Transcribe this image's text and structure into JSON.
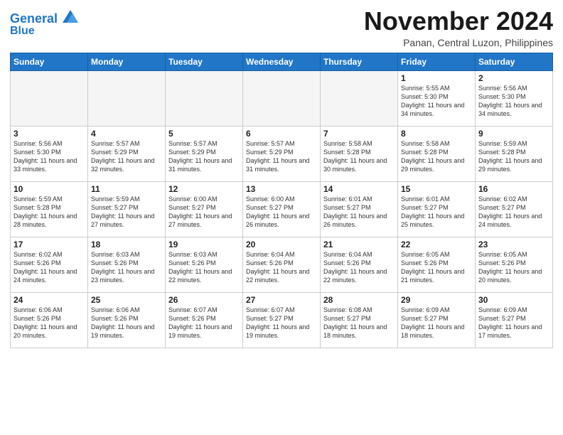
{
  "header": {
    "logo_line1": "General",
    "logo_line2": "Blue",
    "month": "November 2024",
    "location": "Panan, Central Luzon, Philippines"
  },
  "weekdays": [
    "Sunday",
    "Monday",
    "Tuesday",
    "Wednesday",
    "Thursday",
    "Friday",
    "Saturday"
  ],
  "weeks": [
    [
      {
        "day": "",
        "empty": true
      },
      {
        "day": "",
        "empty": true
      },
      {
        "day": "",
        "empty": true
      },
      {
        "day": "",
        "empty": true
      },
      {
        "day": "",
        "empty": true
      },
      {
        "day": "1",
        "sunrise": "5:55 AM",
        "sunset": "5:30 PM",
        "daylight": "11 hours and 34 minutes."
      },
      {
        "day": "2",
        "sunrise": "5:56 AM",
        "sunset": "5:30 PM",
        "daylight": "11 hours and 34 minutes."
      }
    ],
    [
      {
        "day": "3",
        "sunrise": "5:56 AM",
        "sunset": "5:30 PM",
        "daylight": "11 hours and 33 minutes."
      },
      {
        "day": "4",
        "sunrise": "5:57 AM",
        "sunset": "5:29 PM",
        "daylight": "11 hours and 32 minutes."
      },
      {
        "day": "5",
        "sunrise": "5:57 AM",
        "sunset": "5:29 PM",
        "daylight": "11 hours and 31 minutes."
      },
      {
        "day": "6",
        "sunrise": "5:57 AM",
        "sunset": "5:29 PM",
        "daylight": "11 hours and 31 minutes."
      },
      {
        "day": "7",
        "sunrise": "5:58 AM",
        "sunset": "5:28 PM",
        "daylight": "11 hours and 30 minutes."
      },
      {
        "day": "8",
        "sunrise": "5:58 AM",
        "sunset": "5:28 PM",
        "daylight": "11 hours and 29 minutes."
      },
      {
        "day": "9",
        "sunrise": "5:59 AM",
        "sunset": "5:28 PM",
        "daylight": "11 hours and 29 minutes."
      }
    ],
    [
      {
        "day": "10",
        "sunrise": "5:59 AM",
        "sunset": "5:28 PM",
        "daylight": "11 hours and 28 minutes."
      },
      {
        "day": "11",
        "sunrise": "5:59 AM",
        "sunset": "5:27 PM",
        "daylight": "11 hours and 27 minutes."
      },
      {
        "day": "12",
        "sunrise": "6:00 AM",
        "sunset": "5:27 PM",
        "daylight": "11 hours and 27 minutes."
      },
      {
        "day": "13",
        "sunrise": "6:00 AM",
        "sunset": "5:27 PM",
        "daylight": "11 hours and 26 minutes."
      },
      {
        "day": "14",
        "sunrise": "6:01 AM",
        "sunset": "5:27 PM",
        "daylight": "11 hours and 26 minutes."
      },
      {
        "day": "15",
        "sunrise": "6:01 AM",
        "sunset": "5:27 PM",
        "daylight": "11 hours and 25 minutes."
      },
      {
        "day": "16",
        "sunrise": "6:02 AM",
        "sunset": "5:27 PM",
        "daylight": "11 hours and 24 minutes."
      }
    ],
    [
      {
        "day": "17",
        "sunrise": "6:02 AM",
        "sunset": "5:26 PM",
        "daylight": "11 hours and 24 minutes."
      },
      {
        "day": "18",
        "sunrise": "6:03 AM",
        "sunset": "5:26 PM",
        "daylight": "11 hours and 23 minutes."
      },
      {
        "day": "19",
        "sunrise": "6:03 AM",
        "sunset": "5:26 PM",
        "daylight": "11 hours and 22 minutes."
      },
      {
        "day": "20",
        "sunrise": "6:04 AM",
        "sunset": "5:26 PM",
        "daylight": "11 hours and 22 minutes."
      },
      {
        "day": "21",
        "sunrise": "6:04 AM",
        "sunset": "5:26 PM",
        "daylight": "11 hours and 22 minutes."
      },
      {
        "day": "22",
        "sunrise": "6:05 AM",
        "sunset": "5:26 PM",
        "daylight": "11 hours and 21 minutes."
      },
      {
        "day": "23",
        "sunrise": "6:05 AM",
        "sunset": "5:26 PM",
        "daylight": "11 hours and 20 minutes."
      }
    ],
    [
      {
        "day": "24",
        "sunrise": "6:06 AM",
        "sunset": "5:26 PM",
        "daylight": "11 hours and 20 minutes."
      },
      {
        "day": "25",
        "sunrise": "6:06 AM",
        "sunset": "5:26 PM",
        "daylight": "11 hours and 19 minutes."
      },
      {
        "day": "26",
        "sunrise": "6:07 AM",
        "sunset": "5:26 PM",
        "daylight": "11 hours and 19 minutes."
      },
      {
        "day": "27",
        "sunrise": "6:07 AM",
        "sunset": "5:27 PM",
        "daylight": "11 hours and 19 minutes."
      },
      {
        "day": "28",
        "sunrise": "6:08 AM",
        "sunset": "5:27 PM",
        "daylight": "11 hours and 18 minutes."
      },
      {
        "day": "29",
        "sunrise": "6:09 AM",
        "sunset": "5:27 PM",
        "daylight": "11 hours and 18 minutes."
      },
      {
        "day": "30",
        "sunrise": "6:09 AM",
        "sunset": "5:27 PM",
        "daylight": "11 hours and 17 minutes."
      }
    ]
  ]
}
